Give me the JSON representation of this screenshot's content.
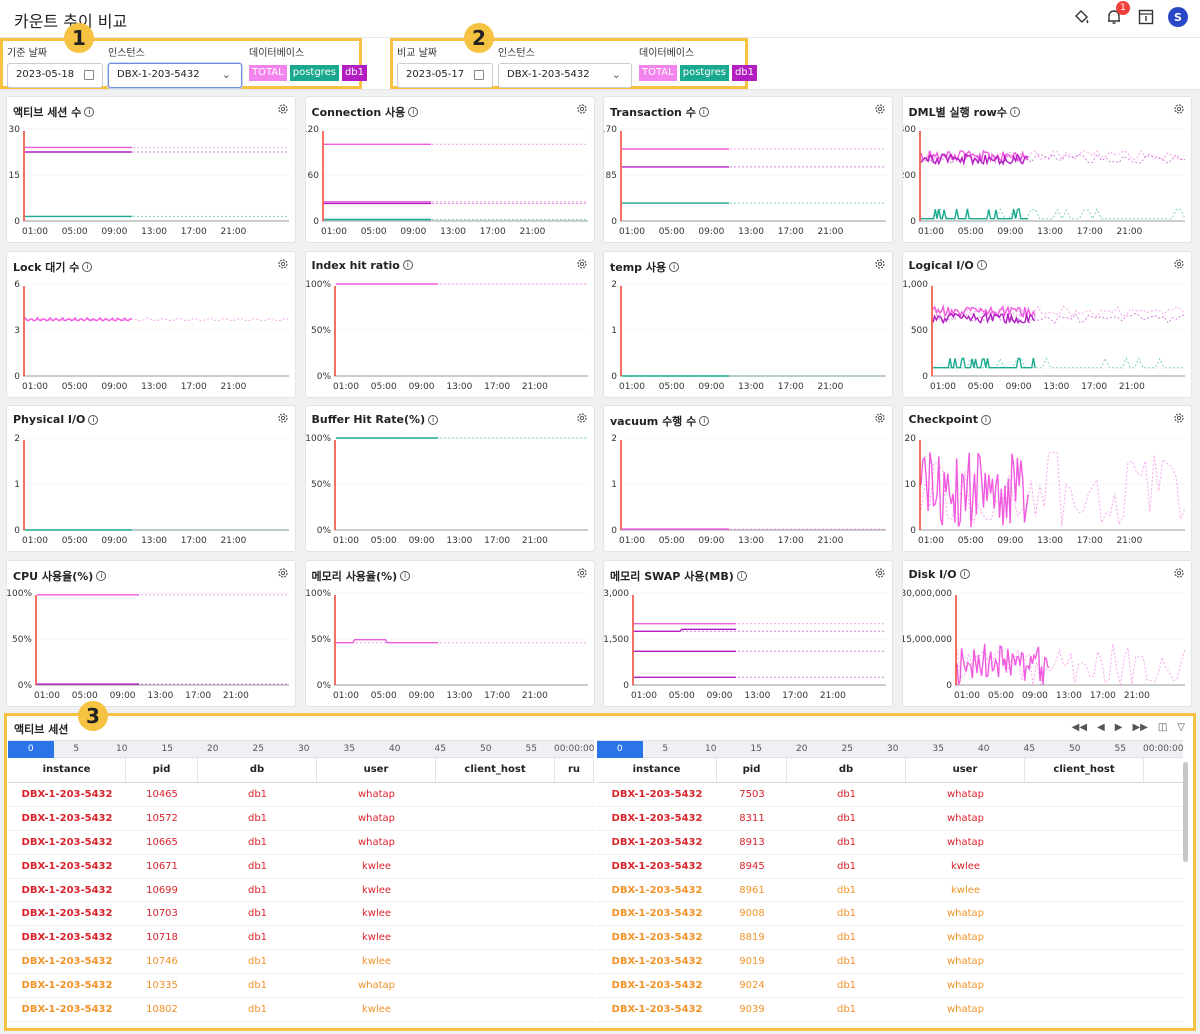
{
  "header": {
    "title": "카운트 추이 비교",
    "notification_count": "1",
    "avatar_initial": "S"
  },
  "filters": [
    {
      "badge": "1",
      "date_label": "기준 날짜",
      "date": "2023-05-18",
      "instance_label": "인스턴스",
      "instance": "DBX-1-203-5432",
      "db_label": "데이터베이스",
      "tags": [
        "TOTAL",
        "postgres",
        "db1"
      ]
    },
    {
      "badge": "2",
      "date_label": "비교 날짜",
      "date": "2023-05-17",
      "instance_label": "인스턴스",
      "instance": "DBX-1-203-5432",
      "db_label": "데이터베이스",
      "tags": [
        "TOTAL",
        "postgres",
        "db1"
      ]
    }
  ],
  "colors": {
    "total": "#f15bdf",
    "postgres": "#1aa98f",
    "db1": "#b31ec3",
    "marker": "#f0412f",
    "badge": "#f5c242",
    "highlight": "#2a74e8"
  },
  "x_ticks": [
    "01:00",
    "05:00",
    "09:00",
    "13:00",
    "17:00",
    "21:00"
  ],
  "charts": [
    {
      "title": "액티브 세션 수",
      "y_ticks": [
        "30",
        "15",
        "0"
      ],
      "ymax": 30,
      "lines": [
        {
          "series": "total",
          "value": 24
        },
        {
          "series": "db1",
          "value": 22.5
        },
        {
          "series": "postgres",
          "value": 1.5
        }
      ]
    },
    {
      "title": "Connection 사용",
      "y_ticks": [
        "120",
        "60",
        "0"
      ],
      "ymax": 120,
      "lines": [
        {
          "series": "total",
          "value": 100
        },
        {
          "series": "total",
          "value": 25
        },
        {
          "series": "db1",
          "value": 23
        },
        {
          "series": "postgres",
          "value": 2
        }
      ]
    },
    {
      "title": "Transaction 수",
      "y_ticks": [
        "170",
        "85",
        "0"
      ],
      "ymax": 170,
      "lines": [
        {
          "series": "total",
          "value": 133
        },
        {
          "series": "db1",
          "value": 100
        },
        {
          "series": "postgres",
          "value": 33
        }
      ]
    },
    {
      "title": "DML별 실행 row수",
      "y_ticks": [
        "400",
        "200",
        "0"
      ],
      "ymax": 400,
      "lines": [
        {
          "series": "total",
          "value": 285,
          "noisy": true
        },
        {
          "series": "db1",
          "value": 270,
          "noisy": true
        },
        {
          "series": "postgres",
          "value": 10,
          "spiky": true
        }
      ]
    },
    {
      "title": "Lock 대기 수",
      "y_ticks": [
        "6",
        "3",
        "0"
      ],
      "ymax": 6,
      "lines": [
        {
          "series": "total",
          "value": 3.8,
          "wave": true
        }
      ]
    },
    {
      "title": "Index hit ratio",
      "y_ticks": [
        "100%",
        "50%",
        "0%"
      ],
      "ymax": 100,
      "lines": [
        {
          "series": "total",
          "value": 100
        }
      ]
    },
    {
      "title": "temp 사용",
      "y_ticks": [
        "2",
        "1",
        "0"
      ],
      "ymax": 2,
      "lines": [
        {
          "series": "postgres",
          "value": 0
        }
      ]
    },
    {
      "title": "Logical I/O",
      "y_ticks": [
        "1,000",
        "500",
        "0"
      ],
      "ymax": 1000,
      "lines": [
        {
          "series": "total",
          "value": 700,
          "noisy": true
        },
        {
          "series": "db1",
          "value": 630,
          "noisy": true
        },
        {
          "series": "postgres",
          "value": 90,
          "spiky": true
        }
      ]
    },
    {
      "title": "Physical I/O",
      "y_ticks": [
        "2",
        "1",
        "0"
      ],
      "ymax": 2,
      "lines": [
        {
          "series": "postgres",
          "value": 0
        }
      ]
    },
    {
      "title": "Buffer Hit Rate(%)",
      "y_ticks": [
        "100%",
        "50%",
        "0%"
      ],
      "ymax": 100,
      "lines": [
        {
          "series": "postgres",
          "value": 100
        }
      ]
    },
    {
      "title": "vacuum 수행 수",
      "y_ticks": [
        "2",
        "1",
        "0"
      ],
      "ymax": 2,
      "lines": [
        {
          "series": "total",
          "value": 0.02
        }
      ]
    },
    {
      "title": "Checkpoint",
      "y_ticks": [
        "20",
        "10",
        "0"
      ],
      "ymax": 20,
      "lines": [
        {
          "series": "total",
          "value": 8,
          "burst": true
        }
      ]
    },
    {
      "title": "CPU 사용율(%)",
      "y_ticks": [
        "100%",
        "50%",
        "0%"
      ],
      "ymax": 100,
      "lines": [
        {
          "series": "total",
          "value": 98
        },
        {
          "series": "db1",
          "value": 1
        }
      ]
    },
    {
      "title": "메모리 사용율(%)",
      "y_ticks": [
        "100%",
        "50%",
        "0%"
      ],
      "ymax": 100,
      "lines": [
        {
          "series": "total",
          "value": 46,
          "bump": true
        }
      ]
    },
    {
      "title": "메모리 SWAP 사용(MB)",
      "y_ticks": [
        "3,000",
        "1,500",
        "0"
      ],
      "ymax": 3000,
      "lines": [
        {
          "series": "total",
          "value": 2000
        },
        {
          "series": "db1",
          "value": 1750,
          "step": true
        },
        {
          "series": "db1",
          "value": 1100
        },
        {
          "series": "db1",
          "value": 250
        }
      ]
    },
    {
      "title": "Disk I/O",
      "y_ticks": [
        "30,000,000",
        "15,000,000",
        "0"
      ],
      "ymax": 30000000,
      "lines": [
        {
          "series": "total",
          "value": 3000000,
          "burst": true
        }
      ]
    }
  ],
  "active_sessions": {
    "title": "액티브 세션",
    "badge": "3",
    "timeline": [
      "0",
      "5",
      "10",
      "15",
      "20",
      "25",
      "30",
      "35",
      "40",
      "45",
      "50",
      "55",
      "00:00:00"
    ],
    "left": {
      "columns": [
        "instance",
        "pid",
        "db",
        "user",
        "client_host",
        "ru"
      ],
      "rows": [
        [
          "DBX-1-203-5432",
          "10465",
          "db1",
          "whatap",
          "red"
        ],
        [
          "DBX-1-203-5432",
          "10572",
          "db1",
          "whatap",
          "red"
        ],
        [
          "DBX-1-203-5432",
          "10665",
          "db1",
          "whatap",
          "red"
        ],
        [
          "DBX-1-203-5432",
          "10671",
          "db1",
          "kwlee",
          "red"
        ],
        [
          "DBX-1-203-5432",
          "10699",
          "db1",
          "kwlee",
          "red"
        ],
        [
          "DBX-1-203-5432",
          "10703",
          "db1",
          "kwlee",
          "red"
        ],
        [
          "DBX-1-203-5432",
          "10718",
          "db1",
          "kwlee",
          "red"
        ],
        [
          "DBX-1-203-5432",
          "10746",
          "db1",
          "kwlee",
          "orange"
        ],
        [
          "DBX-1-203-5432",
          "10335",
          "db1",
          "whatap",
          "orange"
        ],
        [
          "DBX-1-203-5432",
          "10802",
          "db1",
          "kwlee",
          "orange"
        ]
      ]
    },
    "right": {
      "columns": [
        "instance",
        "pid",
        "db",
        "user",
        "client_host"
      ],
      "rows": [
        [
          "DBX-1-203-5432",
          "7503",
          "db1",
          "whatap",
          "red"
        ],
        [
          "DBX-1-203-5432",
          "8311",
          "db1",
          "whatap",
          "red"
        ],
        [
          "DBX-1-203-5432",
          "8913",
          "db1",
          "whatap",
          "red"
        ],
        [
          "DBX-1-203-5432",
          "8945",
          "db1",
          "kwlee",
          "red"
        ],
        [
          "DBX-1-203-5432",
          "8961",
          "db1",
          "kwlee",
          "orange"
        ],
        [
          "DBX-1-203-5432",
          "9008",
          "db1",
          "whatap",
          "orange"
        ],
        [
          "DBX-1-203-5432",
          "8819",
          "db1",
          "whatap",
          "orange"
        ],
        [
          "DBX-1-203-5432",
          "9019",
          "db1",
          "whatap",
          "orange"
        ],
        [
          "DBX-1-203-5432",
          "9024",
          "db1",
          "whatap",
          "orange"
        ],
        [
          "DBX-1-203-5432",
          "9039",
          "db1",
          "whatap",
          "orange"
        ]
      ]
    }
  }
}
